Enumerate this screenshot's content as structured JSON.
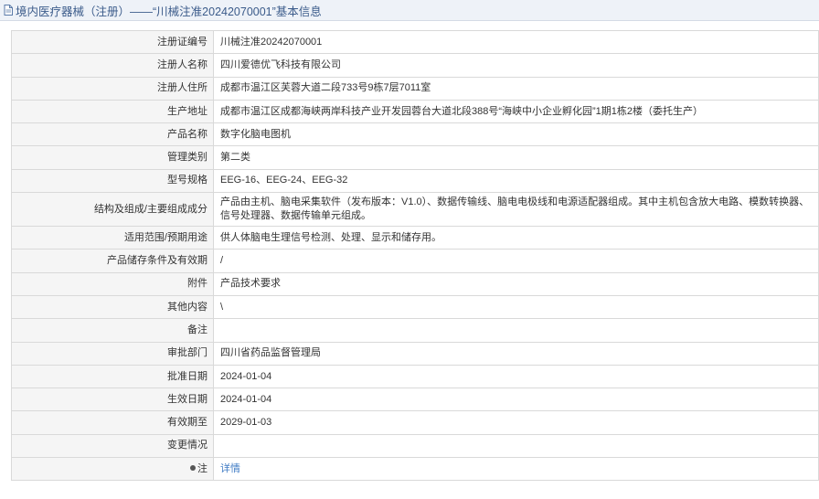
{
  "header": {
    "title": "境内医疗器械（注册）——“川械注准20242070001”基本信息",
    "icon": "document-icon"
  },
  "rows": [
    {
      "label": "注册证编号",
      "value": "川械注准20242070001"
    },
    {
      "label": "注册人名称",
      "value": "四川爱德优飞科技有限公司"
    },
    {
      "label": "注册人住所",
      "value": "成都市温江区芙蓉大道二段733号9栋7层7011室"
    },
    {
      "label": "生产地址",
      "value": "成都市温江区成都海峡两岸科技产业开发园蓉台大道北段388号“海峡中小企业孵化园”1期1栋2楼（委托生产）"
    },
    {
      "label": "产品名称",
      "value": "数字化脑电图机"
    },
    {
      "label": "管理类别",
      "value": "第二类"
    },
    {
      "label": "型号规格",
      "value": "EEG-16、EEG-24、EEG-32"
    },
    {
      "label": "结构及组成/主要组成成分",
      "value": "产品由主机、脑电采集软件（发布版本：V1.0）、数据传输线、脑电电极线和电源适配器组成。其中主机包含放大电路、模数转换器、信号处理器、数据传输单元组成。"
    },
    {
      "label": "适用范围/预期用途",
      "value": "供人体脑电生理信号检测、处理、显示和储存用。"
    },
    {
      "label": "产品储存条件及有效期",
      "value": "/"
    },
    {
      "label": "附件",
      "value": "产品技术要求"
    },
    {
      "label": "其他内容",
      "value": "\\"
    },
    {
      "label": "备注",
      "value": ""
    },
    {
      "label": "审批部门",
      "value": "四川省药品监督管理局"
    },
    {
      "label": "批准日期",
      "value": "2024-01-04"
    },
    {
      "label": "生效日期",
      "value": "2024-01-04"
    },
    {
      "label": "有效期至",
      "value": "2029-01-03"
    },
    {
      "label": "变更情况",
      "value": ""
    }
  ],
  "note_row": {
    "label": "注",
    "link_text": "详情"
  },
  "colors": {
    "title_text": "#3b5b8a",
    "link": "#3f7bc4",
    "label_bg": "#f5f5f5",
    "border": "#d9d9d9"
  }
}
